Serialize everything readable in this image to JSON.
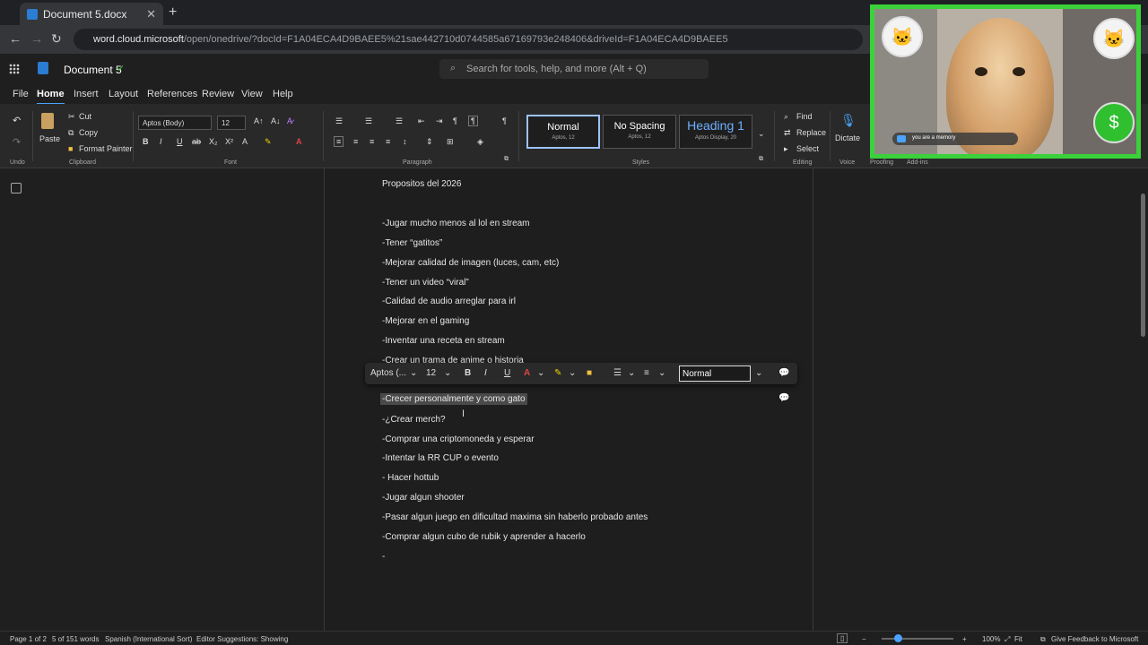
{
  "browser": {
    "tab_title": "Document 5.docx",
    "new_tab_symbol": "+",
    "url_host": "word.cloud.microsoft",
    "url_path": "/open/onedrive/?docId=F1A04ECA4D9BAEE5%21sae442710d0744585a67169793e248406&driveId=F1A04ECA4D9BAEE5"
  },
  "app": {
    "doc_title": "Document 5",
    "search_placeholder": "Search for tools, help, and more (Alt + Q)"
  },
  "menu": [
    "File",
    "Home",
    "Insert",
    "Layout",
    "References",
    "Review",
    "View",
    "Help"
  ],
  "ribbon": {
    "undo_group": "Undo",
    "paste": "Paste",
    "cut": "Cut",
    "copy": "Copy",
    "format_painter": "Format Painter",
    "clipboard_group": "Clipboard",
    "font_name": "Aptos (Body)",
    "font_size": "12",
    "font_group": "Font",
    "paragraph_group": "Paragraph",
    "styles": [
      {
        "name": "Normal",
        "sub": "Aptos, 12"
      },
      {
        "name": "No Spacing",
        "sub": "Aptos, 12"
      },
      {
        "name": "Heading 1",
        "sub": "Aptos Display, 20"
      }
    ],
    "styles_group": "Styles",
    "find": "Find",
    "replace": "Replace",
    "select": "Select",
    "editing_group": "Editing",
    "dictate": "Dictate",
    "voice_group": "Voice",
    "proofing_group": "Proofing",
    "addins_group": "Add-ins"
  },
  "document": {
    "title": "Propositos del 2026",
    "lines": [
      "-Jugar mucho menos al lol en stream",
      "-Tener “gatitos”",
      "-Mejorar calidad de imagen (luces, cam, etc)",
      "-Tener un video “viral”",
      "-Calidad de audio arreglar para irl",
      "-Mejorar en el gaming",
      "-Inventar una receta en stream",
      "-Crear un trama de anime o historia",
      "-Crecer personalmente y como gato",
      "-¿Crear merch?",
      "-Comprar una criptomoneda y esperar",
      "-Intentar la RR CUP o evento",
      "- Hacer hottub",
      "-Jugar algun shooter",
      "-Pasar algun juego en dificultad maxima sin haberlo probado antes",
      "-Comprar algun cubo de rubik y aprender a hacerlo",
      "-"
    ]
  },
  "mini_toolbar": {
    "font": "Aptos (...",
    "size": "12",
    "style": "Normal"
  },
  "status": {
    "page": "Page 1 of 2",
    "words": "5 of 151 words",
    "language": "Spanish (International Sort)",
    "editor": "Editor Suggestions: Showing",
    "zoom": "100%",
    "fit": "Fit",
    "feedback": "Give Feedback to Microsoft"
  },
  "webcam": {
    "caption": "you are a memory"
  },
  "colors": {
    "accent": "#4aa3ff",
    "webcam_border": "#3bd13b",
    "font_color_red": "#e04343",
    "highlight_yellow": "#f0d000"
  }
}
